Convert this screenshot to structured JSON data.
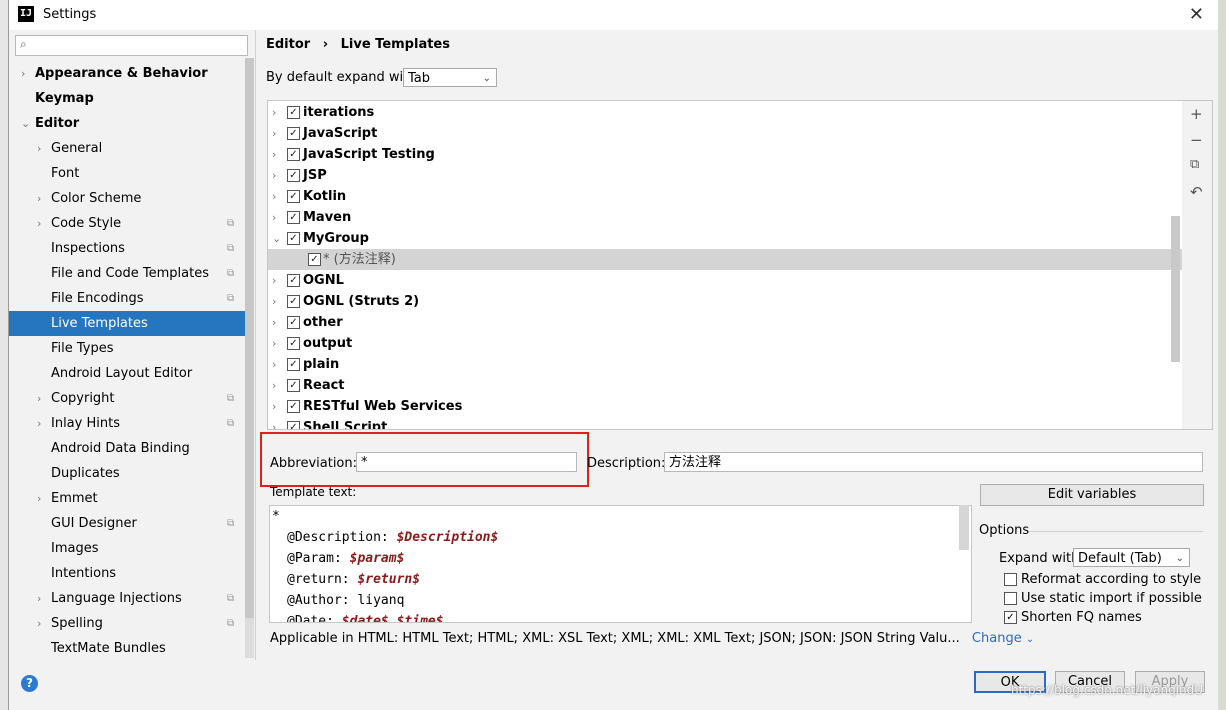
{
  "window": {
    "title": "Settings",
    "app_icon": "IJ"
  },
  "sidebar": {
    "search_placeholder": "",
    "items": [
      {
        "label": "Appearance & Behavior",
        "level": 0,
        "arrow": "›",
        "bold": true
      },
      {
        "label": "Keymap",
        "level": 0,
        "arrow": "",
        "bold": true
      },
      {
        "label": "Editor",
        "level": 0,
        "arrow": "⌄",
        "bold": true
      },
      {
        "label": "General",
        "level": 1,
        "arrow": "›"
      },
      {
        "label": "Font",
        "level": 1,
        "arrow": ""
      },
      {
        "label": "Color Scheme",
        "level": 1,
        "arrow": "›"
      },
      {
        "label": "Code Style",
        "level": 1,
        "arrow": "›",
        "project": true
      },
      {
        "label": "Inspections",
        "level": 1,
        "arrow": "",
        "project": true
      },
      {
        "label": "File and Code Templates",
        "level": 1,
        "arrow": "",
        "project": true
      },
      {
        "label": "File Encodings",
        "level": 1,
        "arrow": "",
        "project": true
      },
      {
        "label": "Live Templates",
        "level": 1,
        "arrow": "",
        "selected": true
      },
      {
        "label": "File Types",
        "level": 1,
        "arrow": ""
      },
      {
        "label": "Android Layout Editor",
        "level": 1,
        "arrow": ""
      },
      {
        "label": "Copyright",
        "level": 1,
        "arrow": "›",
        "project": true
      },
      {
        "label": "Inlay Hints",
        "level": 1,
        "arrow": "›",
        "project": true
      },
      {
        "label": "Android Data Binding",
        "level": 1,
        "arrow": ""
      },
      {
        "label": "Duplicates",
        "level": 1,
        "arrow": ""
      },
      {
        "label": "Emmet",
        "level": 1,
        "arrow": "›"
      },
      {
        "label": "GUI Designer",
        "level": 1,
        "arrow": "",
        "project": true
      },
      {
        "label": "Images",
        "level": 1,
        "arrow": ""
      },
      {
        "label": "Intentions",
        "level": 1,
        "arrow": ""
      },
      {
        "label": "Language Injections",
        "level": 1,
        "arrow": "›",
        "project": true
      },
      {
        "label": "Spelling",
        "level": 1,
        "arrow": "›",
        "project": true
      },
      {
        "label": "TextMate Bundles",
        "level": 1,
        "arrow": ""
      }
    ]
  },
  "breadcrumb": {
    "parent": "Editor",
    "sep": "›",
    "current": "Live Templates"
  },
  "expand": {
    "label": "By default expand with",
    "value": "Tab"
  },
  "tree": [
    {
      "label": "iterations",
      "arrow": "›"
    },
    {
      "label": "JavaScript",
      "arrow": "›"
    },
    {
      "label": "JavaScript Testing",
      "arrow": "›"
    },
    {
      "label": "JSP",
      "arrow": "›"
    },
    {
      "label": "Kotlin",
      "arrow": "›"
    },
    {
      "label": "Maven",
      "arrow": "›"
    },
    {
      "label": "MyGroup",
      "arrow": "⌄"
    },
    {
      "label": "* (方法注释)",
      "arrow": "",
      "child": true,
      "selected": true
    },
    {
      "label": "OGNL",
      "arrow": "›"
    },
    {
      "label": "OGNL (Struts 2)",
      "arrow": "›"
    },
    {
      "label": "other",
      "arrow": "›"
    },
    {
      "label": "output",
      "arrow": "›"
    },
    {
      "label": "plain",
      "arrow": "›"
    },
    {
      "label": "React",
      "arrow": "›"
    },
    {
      "label": "RESTful Web Services",
      "arrow": "›"
    },
    {
      "label": "Shell Script",
      "arrow": "›"
    }
  ],
  "tools": {
    "add": "+",
    "remove": "−",
    "copy": "⧉",
    "restore": "↶"
  },
  "abbreviation": {
    "label": "Abbreviation:",
    "value": "*"
  },
  "description": {
    "label": "Description:",
    "value": "方法注释"
  },
  "template": {
    "label": "Template text:",
    "lines": [
      {
        "text": "*",
        "var": "",
        "indent": false
      },
      {
        "text": "@Description: ",
        "var": "$Description$",
        "indent": true
      },
      {
        "text": "@Param: ",
        "var": "$param$",
        "indent": true
      },
      {
        "text": "@return: ",
        "var": "$return$",
        "indent": true
      },
      {
        "text": "@Author: liyanq",
        "var": "",
        "indent": true
      },
      {
        "text": "@Date: ",
        "var": "$date$ $time$",
        "indent": true
      }
    ]
  },
  "edit_variables": "Edit variables",
  "options": {
    "title": "Options",
    "expand_label": "Expand with",
    "expand_value": "Default (Tab)",
    "reformat": {
      "label": "Reformat according to style",
      "checked": false
    },
    "static_import": {
      "label": "Use static import if possible",
      "checked": false
    },
    "shorten_fq": {
      "label": "Shorten FQ names",
      "checked": true
    }
  },
  "applicable": {
    "text": "Applicable in HTML: HTML Text; HTML; XML: XSL Text; XML; XML: XML Text; JSON; JSON: JSON String Valu...",
    "change": "Change"
  },
  "buttons": {
    "ok": "OK",
    "cancel": "Cancel",
    "apply": "Apply"
  },
  "help": "?",
  "watermark": "https://blog.csdn.net/liyanqindU"
}
